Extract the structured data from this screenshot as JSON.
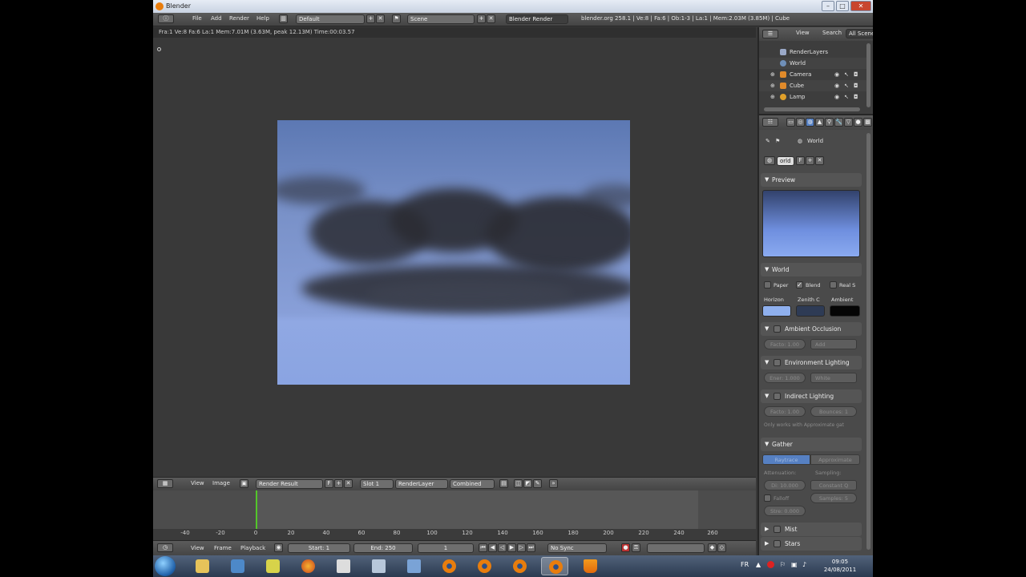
{
  "window": {
    "title": "Blender"
  },
  "info_header": {
    "menus": [
      "File",
      "Add",
      "Render",
      "Help"
    ],
    "layout": "Default",
    "scene": "Scene",
    "engine": "Blender Render",
    "stats": "blender.org 258.1 | Ve:8 | Fa:6 | Ob:1-3 | La:1 | Mem:2.03M (3.85M) | Cube"
  },
  "render_status": "Fra:1  Ve:8 Fa:6 La:1 Mem:7.01M (3.63M, peak 12.13M) Time:00:03.57",
  "image_editor_header": {
    "menus": [
      "View",
      "Image"
    ],
    "image_name": "Render Result",
    "pin": "F",
    "slot": "Slot 1",
    "layer": "RenderLayer",
    "pass": "Combined"
  },
  "timeline": {
    "ticks": [
      "-40",
      "-20",
      "0",
      "20",
      "40",
      "60",
      "80",
      "100",
      "120",
      "140",
      "160",
      "180",
      "200",
      "220",
      "240",
      "260"
    ],
    "current_frame": 1,
    "menus": [
      "View",
      "Frame",
      "Playback"
    ],
    "start": "Start: 1",
    "end": "End: 250",
    "frame": "1",
    "sync": "No Sync"
  },
  "outliner": {
    "menus": [
      "View",
      "Search"
    ],
    "filter": "All Scenes",
    "items": [
      {
        "label": "RenderLayers",
        "icon_color": "#9aa9c8"
      },
      {
        "label": "World",
        "icon_color": "#6f8fb8"
      },
      {
        "label": "Camera",
        "icon_color": "#e08a2a"
      },
      {
        "label": "Cube",
        "icon_color": "#e08a2a"
      },
      {
        "label": "Lamp",
        "icon_color": "#e0a02a"
      }
    ]
  },
  "properties": {
    "breadcrumb": "World",
    "world_datablock": "orld",
    "world_users": "F",
    "preview_title": "Preview",
    "world_panel": {
      "title": "World",
      "checks": [
        "Paper",
        "Blend",
        "Real S"
      ],
      "checked": [
        false,
        true,
        false
      ],
      "color_labels": [
        "Horizon",
        "Zenith C",
        "Ambient"
      ],
      "colors": [
        "#8fb0ee",
        "#2e3b55",
        "#050505"
      ]
    },
    "ambient_occlusion": {
      "title": "Ambient Occlusion",
      "factor": "Facto: 1.00",
      "mode": "Add"
    },
    "environment_lighting": {
      "title": "Environment Lighting",
      "energy": "Ener: 1.000",
      "color": "White"
    },
    "indirect_lighting": {
      "title": "Indirect Lighting",
      "factor": "Facto: 1.00",
      "bounces": "Bounces: 1",
      "note": "Only works with Approximate gat"
    },
    "gather": {
      "title": "Gather",
      "methods": [
        "Raytrace",
        "Approximate"
      ],
      "attenuation_label": "Attenuation:",
      "sampling_label": "Sampling:",
      "distance": "Di: 10.000",
      "sampling": "Constant Q",
      "falloff": "Falloff",
      "samples": "Samples: 5",
      "strength": "Stre: 0.000"
    },
    "collapsed": [
      "Mist",
      "Stars"
    ]
  },
  "taskbar": {
    "language": "FR",
    "time": "09:05",
    "date": "24/08/2011"
  },
  "colors": {
    "accent": "#5680c2",
    "frame_marker": "#53c62a",
    "blender_orange": "#e87d0d"
  }
}
